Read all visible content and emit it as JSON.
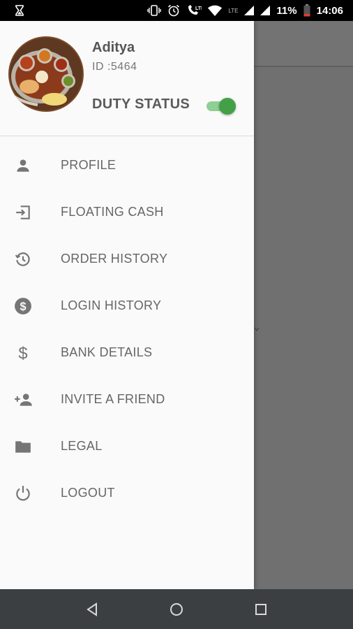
{
  "status_bar": {
    "network": "LTE",
    "battery": "11%",
    "time": "14:06"
  },
  "drawer": {
    "user": {
      "name": "Aditya",
      "id": "ID :5464"
    },
    "duty_status": {
      "label": "DUTY STATUS",
      "on": true
    },
    "menu": [
      {
        "label": "PROFILE",
        "icon": "person-icon"
      },
      {
        "label": "FLOATING CASH",
        "icon": "login-arrow-icon"
      },
      {
        "label": "ORDER HISTORY",
        "icon": "history-icon"
      },
      {
        "label": "LOGIN HISTORY",
        "icon": "dollar-circle-icon"
      },
      {
        "label": "BANK DETAILS",
        "icon": "dollar-icon"
      },
      {
        "label": "INVITE A FRIEND",
        "icon": "person-add-icon"
      },
      {
        "label": "LEGAL",
        "icon": "folder-icon"
      },
      {
        "label": "LOGOUT",
        "icon": "power-icon"
      }
    ]
  },
  "colors": {
    "accent": "#43a047",
    "icon": "#757575",
    "scrim": "#6f6f6f"
  }
}
